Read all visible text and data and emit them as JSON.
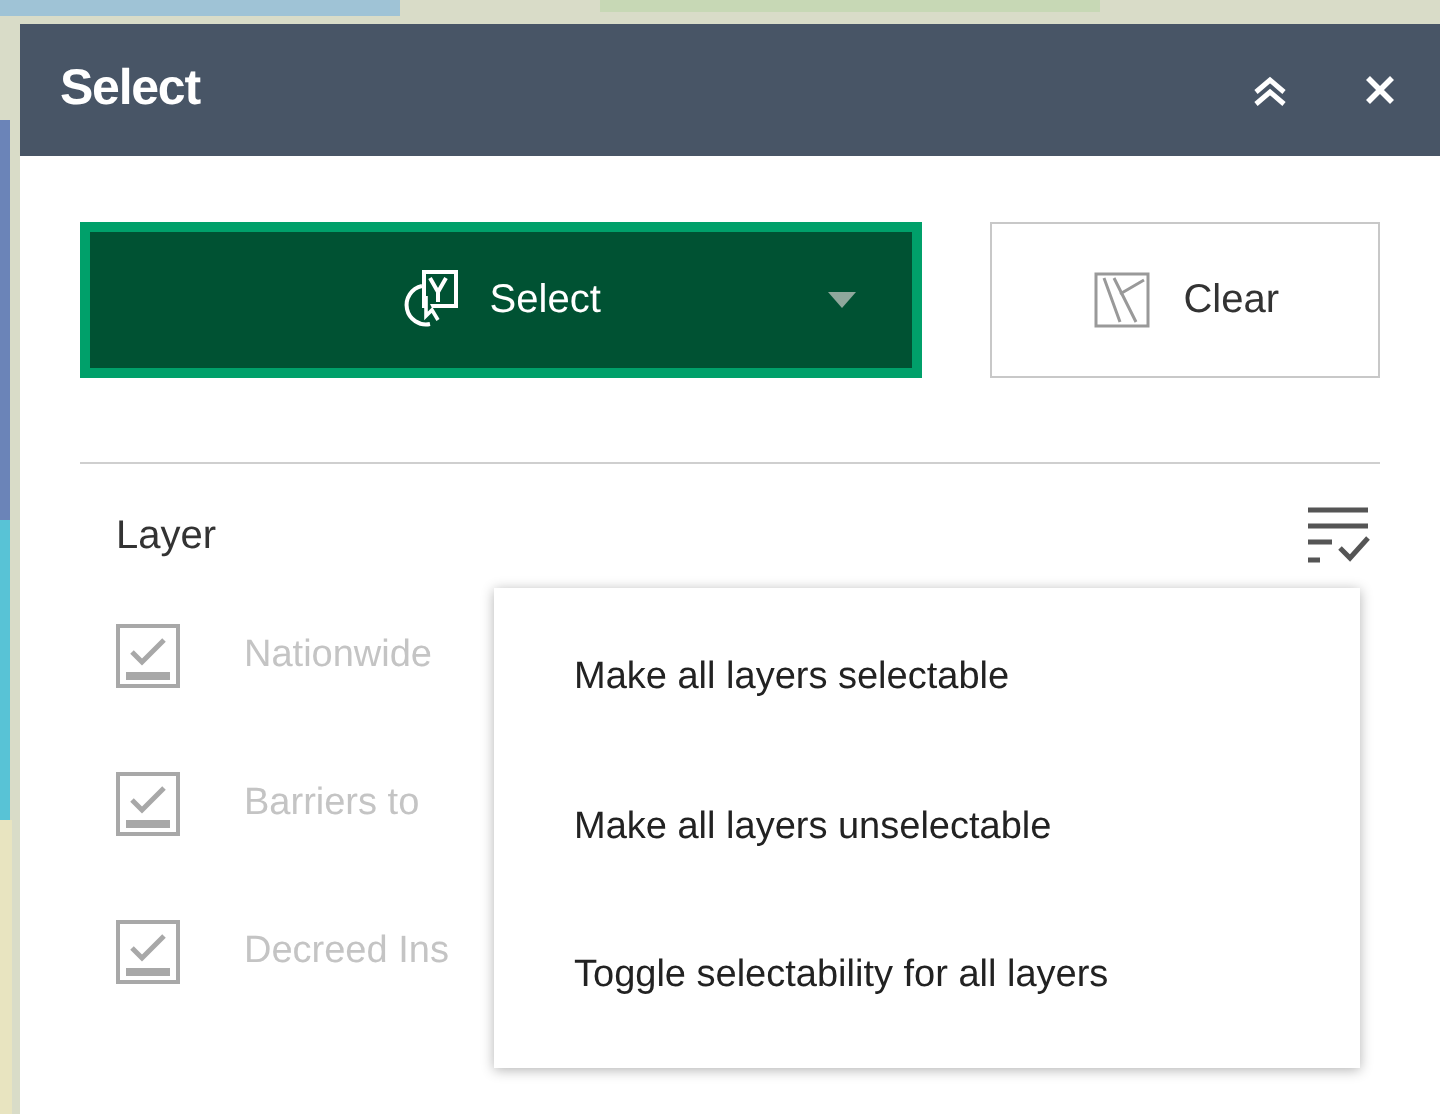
{
  "panel": {
    "title": "Select"
  },
  "select_button": {
    "label": "Select"
  },
  "clear_button": {
    "label": "Clear"
  },
  "layer_header": {
    "label": "Layer"
  },
  "layers": [
    {
      "name": "Nationwide",
      "checked": true
    },
    {
      "name": "Barriers to",
      "checked": true
    },
    {
      "name": "Decreed Ins",
      "checked": true
    }
  ],
  "menu": {
    "items": [
      "Make all layers selectable",
      "Make all layers unselectable",
      "Toggle selectability for all layers"
    ]
  }
}
